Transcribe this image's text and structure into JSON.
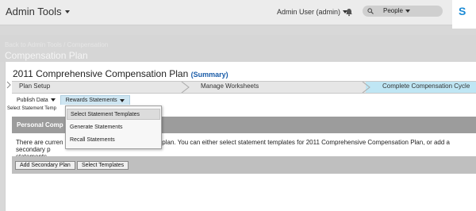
{
  "header": {
    "app_title": "Admin Tools",
    "user": "Admin User (admin)",
    "search_scope": "People",
    "logo_text": "S"
  },
  "page": {
    "breadcrumb": "Back to Admin Tools / Compensation",
    "title": "Compensation Plan"
  },
  "plan": {
    "name": "2011 Comprehensive Compensation Plan",
    "summary_link": "(Summary)"
  },
  "steps": [
    {
      "label": "Plan Setup"
    },
    {
      "label": "Manage Worksheets"
    },
    {
      "label": "Complete Compensation Cycle"
    }
  ],
  "subnav": {
    "publish": "Publish Data",
    "rewards": "Rewards Statements"
  },
  "select_statement_text": "Select Statement Temp",
  "section": {
    "title": "Personal Comp",
    "info_left": "There are curren",
    "info_right": "this plan. You can either select statement templates for 2011 Comprehensive Compensation Plan, or add a secondary p",
    "info_line2": "statements."
  },
  "buttons": {
    "add_secondary": "Add Secondary Plan",
    "select_templates": "Select Templates"
  },
  "dropdown": {
    "items": [
      "Select Statement Templates",
      "Generate Statements",
      "Recall Statements"
    ]
  },
  "colors": {
    "active_step": "#bfe6f4",
    "section_head": "#9c9c9c",
    "link": "#1a5ca8"
  }
}
